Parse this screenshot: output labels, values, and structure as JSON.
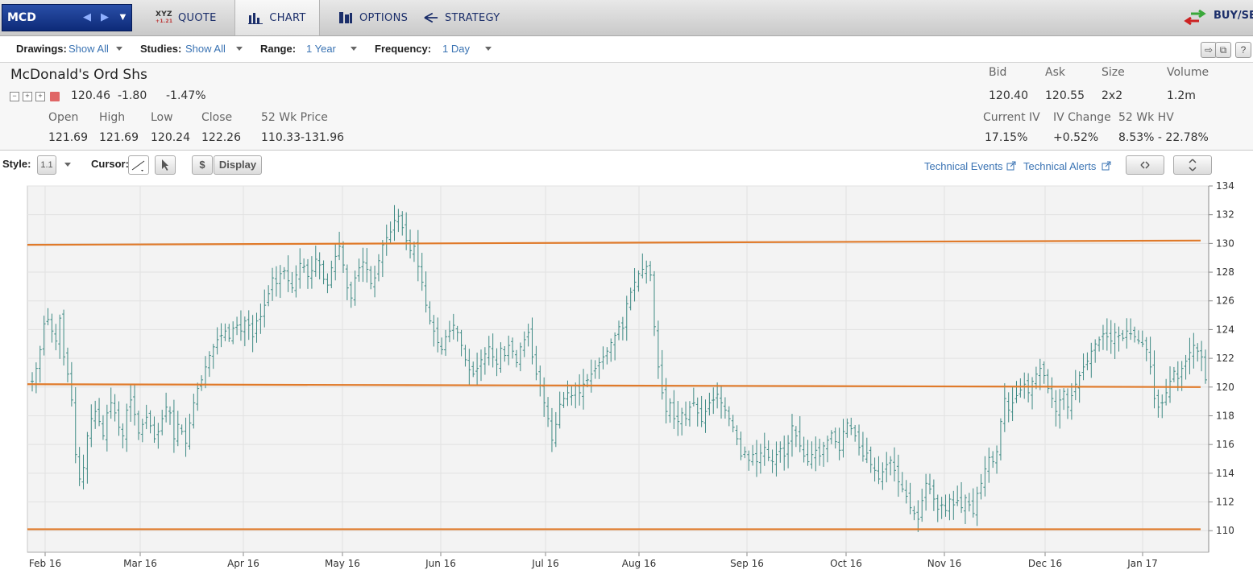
{
  "nav": {
    "symbol": "MCD",
    "tabs": [
      {
        "label": "QUOTE",
        "icon": "xyz-quote-icon"
      },
      {
        "label": "CHART",
        "icon": "bar-chart-icon"
      },
      {
        "label": "OPTIONS",
        "icon": "options-icon"
      },
      {
        "label": "STRATEGY",
        "icon": "strategy-icon"
      }
    ],
    "buysell": "BUY/SEL",
    "quote_icon_text": "XYZ",
    "quote_icon_sub": "+1.21"
  },
  "toolbar": {
    "drawings_label": "Drawings:",
    "drawings_value": "Show All",
    "studies_label": "Studies:",
    "studies_value": "Show All",
    "range_label": "Range:",
    "range_value": "1 Year",
    "frequency_label": "Frequency:",
    "frequency_value": "1 Day",
    "help": "?"
  },
  "quote": {
    "name": "McDonald's Ord Shs",
    "last": "120.46",
    "change": "-1.80",
    "change_pct": "-1.47%",
    "open_label": "Open",
    "open": "121.69",
    "high_label": "High",
    "high": "121.69",
    "low_label": "Low",
    "low": "120.24",
    "close_label": "Close",
    "close": "122.26",
    "wk52_label": "52 Wk Price",
    "wk52": "110.33-131.96",
    "bid_label": "Bid",
    "bid": "120.40",
    "ask_label": "Ask",
    "ask": "120.55",
    "size_label": "Size",
    "size": "2x2",
    "volume_label": "Volume",
    "volume": "1.2m",
    "iv_label": "Current IV",
    "iv": "17.15%",
    "ivchg_label": "IV Change",
    "ivchg": "+0.52%",
    "hv_label": "52 Wk HV",
    "hv": "8.53% - 22.78%"
  },
  "stylebar": {
    "style_label": "Style:",
    "style_value": "1.1",
    "cursor_label": "Cursor:",
    "dollar": "$",
    "display": "Display",
    "tech_events": "Technical Events",
    "tech_alerts": "Technical Alerts"
  },
  "chart_data": {
    "type": "ohlc-bar",
    "xlabels": [
      "Feb 16",
      "Mar 16",
      "Apr 16",
      "May 16",
      "Jun 16",
      "Jul 16",
      "Aug 16",
      "Sep 16",
      "Oct 16",
      "Nov 16",
      "Dec 16",
      "Jan 17"
    ],
    "ylabels": [
      "134",
      "132",
      "130",
      "128",
      "126",
      "124",
      "122",
      "120",
      "118",
      "116",
      "114",
      "112",
      "110"
    ],
    "ylim": [
      108.5,
      134
    ],
    "trendlines": [
      {
        "from": [
          0,
          129.9
        ],
        "to": [
          1,
          130.2
        ]
      },
      {
        "from": [
          0,
          120.2
        ],
        "to": [
          1,
          120.0
        ]
      },
      {
        "from": [
          0,
          110.1
        ],
        "to": [
          1,
          110.1
        ]
      }
    ],
    "closes": [
      120.4,
      121.3,
      122.6,
      124.4,
      124.7,
      123.9,
      123.2,
      124.8,
      122.1,
      120.9,
      119.1,
      115.3,
      113.6,
      114.4,
      116.6,
      117.8,
      118.3,
      117.6,
      116.6,
      118.2,
      118.9,
      118.2,
      117.2,
      116.6,
      118.4,
      119.1,
      118.1,
      116.8,
      117.4,
      117.9,
      117.3,
      116.4,
      116.9,
      117.8,
      118.6,
      118.2,
      116.4,
      117.4,
      116.9,
      116.1,
      117.5,
      118.9,
      119.9,
      120.5,
      121.4,
      122.2,
      122.8,
      123.3,
      123.6,
      123.9,
      123.4,
      124.1,
      124.3,
      123.9,
      124.6,
      124.3,
      123.5,
      124.6,
      124.9,
      125.7,
      126.5,
      127.6,
      127.2,
      127.9,
      128.1,
      127.4,
      126.9,
      127.8,
      128.6,
      128.4,
      127.7,
      128.1,
      128.9,
      128.5,
      127.5,
      127.1,
      128.3,
      129.1,
      129.8,
      128.5,
      126.9,
      126.2,
      127.6,
      128.3,
      128.7,
      128.2,
      127.2,
      127.6,
      128.8,
      129.9,
      130.4,
      130.8,
      131.6,
      131.9,
      131.1,
      130.2,
      129.5,
      129.8,
      128.4,
      127.3,
      125.7,
      124.6,
      123.9,
      123.1,
      122.6,
      123.5,
      123.9,
      124.3,
      123.8,
      122.9,
      121.9,
      121.2,
      120.9,
      121.3,
      121.9,
      122.3,
      122.8,
      122.1,
      121.6,
      122.7,
      122.2,
      122.9,
      122.5,
      121.7,
      122.8,
      123.3,
      123.8,
      122.1,
      120.9,
      120.1,
      118.9,
      117.8,
      116.3,
      117.4,
      118.8,
      119.2,
      119.6,
      119.4,
      120.1,
      119.6,
      120.2,
      120.5,
      120.9,
      121.3,
      121.7,
      122.1,
      122.5,
      123.1,
      123.6,
      124.2,
      124.1,
      125.8,
      126.6,
      127.3,
      127.9,
      128.2,
      128.4,
      127.8,
      124.2,
      121.4,
      119.6,
      118.3,
      118.9,
      117.8,
      117.6,
      118.2,
      117.8,
      118.6,
      118.9,
      118.2,
      117.6,
      118.3,
      118.9,
      119.1,
      119.5,
      118.9,
      118.4,
      117.8,
      117.2,
      116.4,
      115.2,
      115.5,
      114.9,
      115.3,
      114.8,
      115.4,
      115.8,
      115.1,
      114.8,
      115.3,
      115.7,
      115.2,
      116.1,
      117.3,
      116.6,
      115.9,
      115.2,
      114.8,
      115.3,
      115.6,
      115.2,
      115.9,
      116.3,
      116.8,
      116.2,
      115.6,
      116.9,
      117.5,
      117.1,
      116.6,
      115.8,
      115.2,
      115.4,
      114.6,
      114.2,
      113.6,
      114.1,
      114.6,
      114.9,
      114.2,
      113.4,
      112.9,
      112.4,
      111.6,
      111.2,
      110.8,
      112.1,
      113.3,
      112.9,
      112.2,
      111.5,
      111.8,
      111.4,
      112.2,
      111.8,
      112.1,
      111.6,
      112.3,
      111.8,
      111.2,
      112.6,
      113.3,
      114.3,
      115.1,
      114.8,
      115.5,
      117.6,
      119.2,
      118.4,
      118.9,
      119.4,
      119.8,
      120.2,
      119.6,
      120.4,
      120.9,
      121.3,
      120.8,
      119.9,
      119.2,
      118.3,
      119.1,
      119.7,
      118.6,
      119.4,
      120.2,
      120.8,
      121.4,
      121.8,
      122.5,
      123.0,
      123.3,
      123.7,
      123.5,
      123.2,
      123.8,
      123.6,
      123.4,
      123.9,
      123.7,
      123.5,
      123.2,
      123.0,
      122.6,
      121.4,
      119.2,
      118.6,
      118.9,
      119.6,
      120.4,
      121.1,
      120.6,
      121.3,
      121.8,
      122.4,
      122.9,
      122.5,
      122.1,
      120.5
    ]
  }
}
